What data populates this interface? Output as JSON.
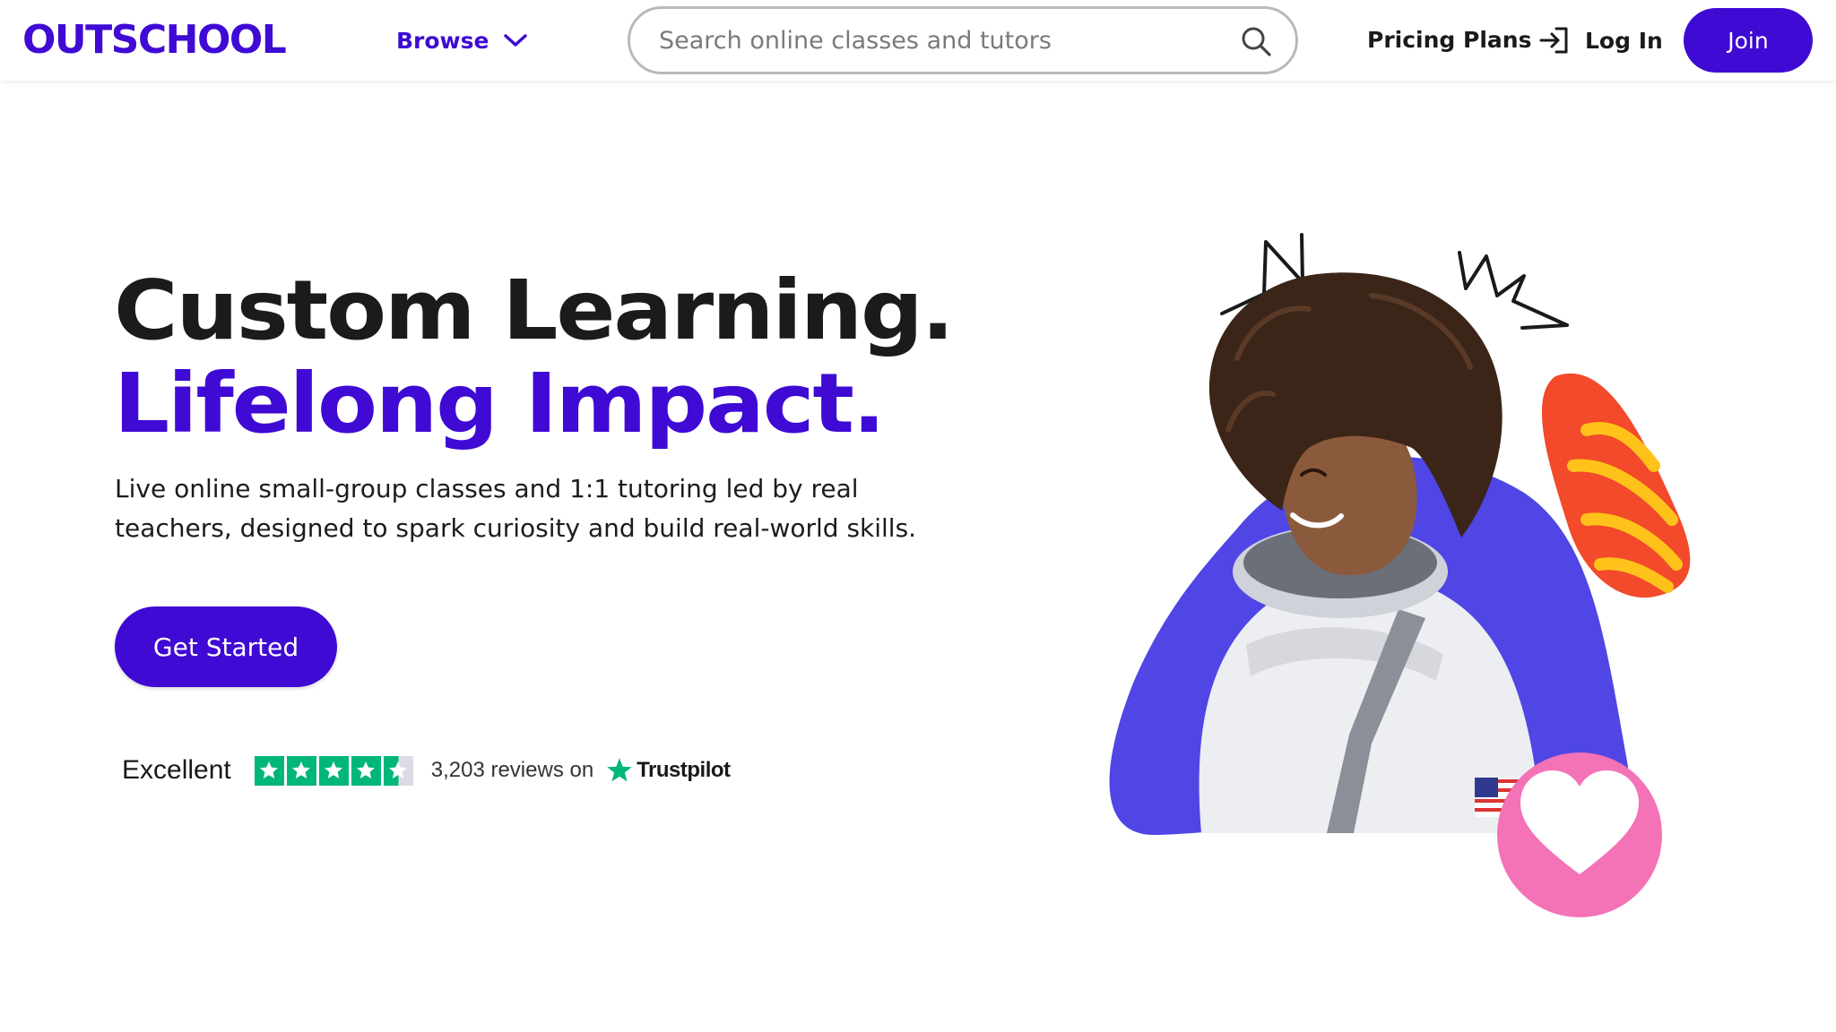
{
  "header": {
    "logo_text": "OUTSCHOOL",
    "browse_label": "Browse",
    "search_placeholder": "Search online classes and tutors",
    "pricing_label": "Pricing Plans",
    "login_label": "Log In",
    "join_label": "Join"
  },
  "hero": {
    "headline_line1": "Custom Learning.",
    "headline_line2": "Lifelong Impact.",
    "subcopy": "Live online small-group classes and 1:1 tutoring led by real teachers, designed to spark curiosity and build real-world skills.",
    "cta_label": "Get Started"
  },
  "trustpilot": {
    "rating_word": "Excellent",
    "stars": 4.5,
    "reviews_text": "3,203 reviews on",
    "brand": "Trustpilot"
  },
  "illustration": {
    "subject": "smiling child in white astronaut suit",
    "icons": [
      "heart-icon",
      "crown-doodle"
    ]
  },
  "colors": {
    "brand_purple": "#3f0ad4",
    "blob_blue": "#4f46e5",
    "blob_orange": "#f24a2a",
    "heart_pink": "#f472b6",
    "trustpilot_green": "#00b67a"
  }
}
